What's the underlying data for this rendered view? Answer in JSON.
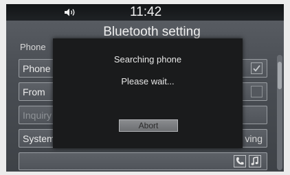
{
  "status_bar": {
    "time": "11:42",
    "volume_icon": "speaker-volume-icon"
  },
  "screen": {
    "title": "Bluetooth setting",
    "section_label": "Phone",
    "rows": [
      {
        "label": "Phone",
        "control": "checkbox",
        "checked": true
      },
      {
        "label": "From",
        "control": "box"
      },
      {
        "label": "Inquiry",
        "dimmed": true
      },
      {
        "label": "System",
        "value": "ving"
      },
      {
        "label": "",
        "icons": [
          "phone-icon",
          "music-icon"
        ]
      }
    ]
  },
  "dialog": {
    "message_line1": "Searching phone",
    "message_line2": "Please wait...",
    "abort_label": "Abort"
  },
  "colors": {
    "dialog_background": "#1a1b1c",
    "screen_background": "#4a4e54",
    "status_bar": "#121416"
  }
}
